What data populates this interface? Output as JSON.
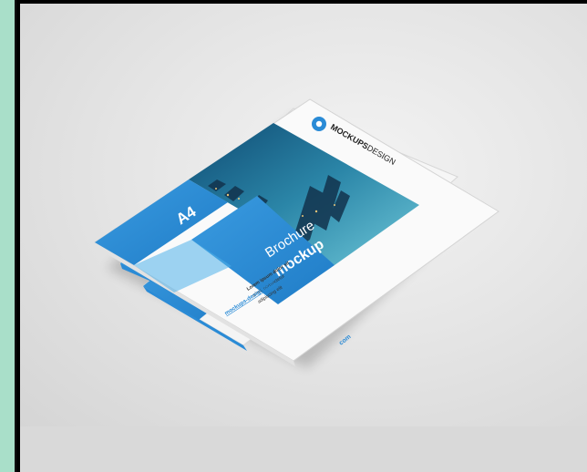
{
  "scene": {
    "description_colors": {
      "accent_blue": "#2a8bd6",
      "light_blue": "#4fb0ea",
      "paper": "#fafafa",
      "side_band": "#a9dfc9"
    }
  },
  "brochure": {
    "brand_bold": "MOCKUPS",
    "brand_light": "DESIGN",
    "size_label": "A4",
    "title_light": "Brochure",
    "title_bold": "mockup",
    "body_line_1": "Lorem ipsum dolor sit",
    "body_line_2": "amet, consectetur",
    "body_line_3": "adipiscing elit",
    "url": "mockups-design.com",
    "back_url_fragment": "com"
  }
}
